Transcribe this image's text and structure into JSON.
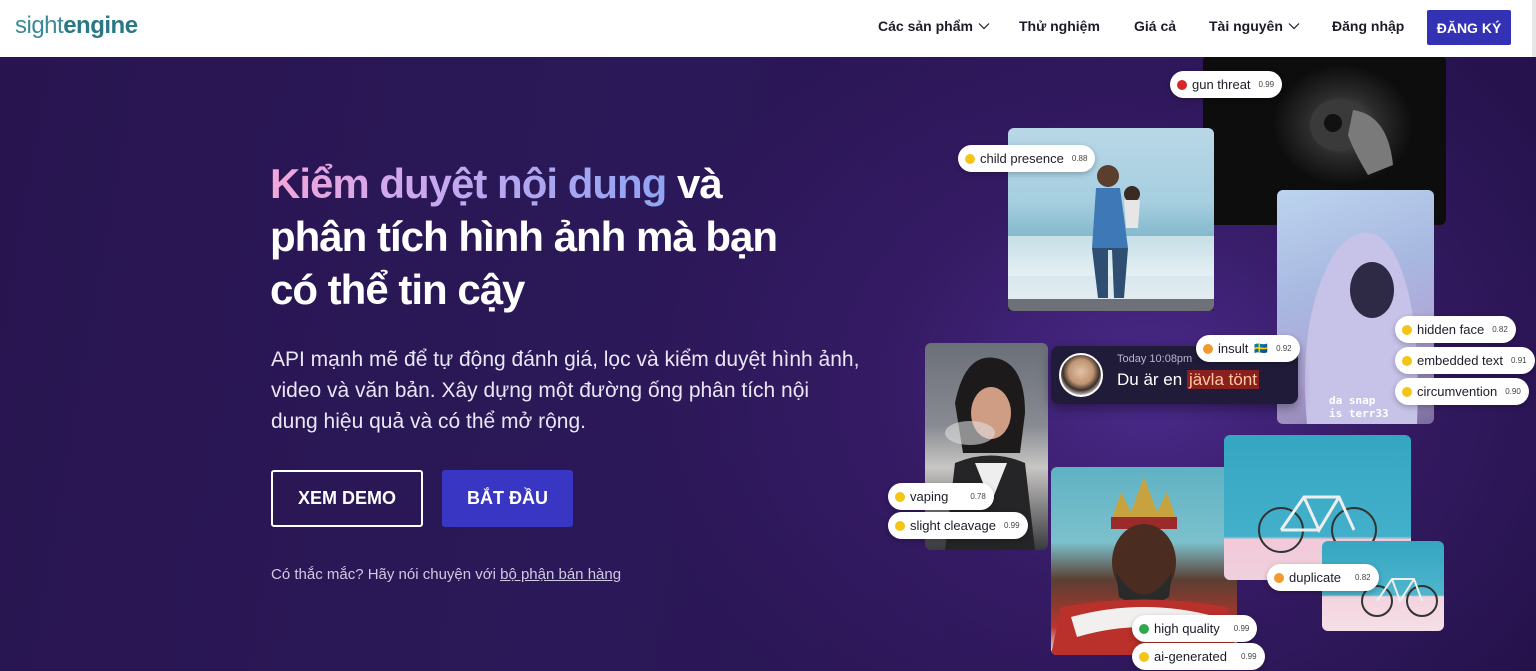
{
  "nav": {
    "logo_light": "sight",
    "logo_bold": "engine",
    "items": [
      "Các sản phẩm",
      "Thử nghiệm",
      "Giá cả",
      "Tài nguyên",
      "Đăng nhập"
    ],
    "signup": "ĐĂNG KÝ"
  },
  "hero": {
    "title_highlight": "Kiểm duyệt nội dung",
    "title_rest_1": " và",
    "title_line2": "phân tích hình ảnh mà bạn",
    "title_line3": "có thể tin cậy",
    "subtitle": "API mạnh mẽ để tự động đánh giá, lọc và kiểm duyệt hình ảnh, video và văn bản. Xây dựng một đường ống phân tích nội dung hiệu quả và có thể mở rộng.",
    "demo_button": "XEM DEMO",
    "start_button": "BẮT ĐẦU",
    "question": "Có thắc mắc? Hãy nói chuyện với ",
    "sales_link": "bộ phận bán hàng"
  },
  "chat": {
    "time": "Today 10:08pm",
    "message_plain": "Du är en ",
    "message_flagged": "jävla tönt"
  },
  "tags": [
    {
      "label": "gun threat",
      "score": "0.99",
      "color": "#d7262b"
    },
    {
      "label": "child presence",
      "score": "0.88",
      "color": "#f2c517"
    },
    {
      "label": "insult",
      "score": "0.92",
      "color": "#f29a2e",
      "flag": "🇸🇪"
    },
    {
      "label": "hidden face",
      "score": "0.82",
      "color": "#f2c517"
    },
    {
      "label": "embedded text",
      "score": "0.91",
      "color": "#f2c517"
    },
    {
      "label": "circumvention",
      "score": "0.90",
      "color": "#f2c517"
    },
    {
      "label": "vaping",
      "score": "0.78",
      "color": "#f2c517"
    },
    {
      "label": "slight cleavage",
      "score": "0.99",
      "color": "#f2c517"
    },
    {
      "label": "duplicate",
      "score": "0.82",
      "color": "#f29a2e"
    },
    {
      "label": "high quality",
      "score": "0.99",
      "color": "#2fa84f"
    },
    {
      "label": "ai-generated",
      "score": "0.99",
      "color": "#f2c517"
    }
  ],
  "photo_text": "da snap\nis terr33",
  "colors": {
    "brand": "#2a7886",
    "accent": "#3432b4",
    "hero_bg": "#2a1554"
  }
}
